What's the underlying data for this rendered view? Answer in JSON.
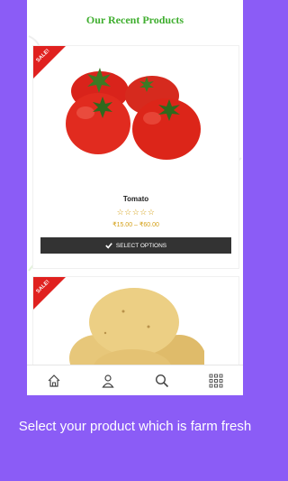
{
  "colors": {
    "background": "#8b5cf6",
    "title_green": "#3fae2f",
    "sale_red": "#e0211f",
    "price_gold": "#d4a017",
    "button_dark": "#333333"
  },
  "section": {
    "title": "Our Recent Products"
  },
  "products": [
    {
      "badge": "SALE!",
      "name": "Tomato",
      "rating_stars": "☆☆☆☆☆",
      "price": "₹15.00 – ₹60.00",
      "button_label": "SELECT OPTIONS",
      "button_icon": "check-icon"
    },
    {
      "badge": "SALE!"
    }
  ],
  "bottom_nav": {
    "items": [
      "home-icon",
      "account-icon",
      "search-icon",
      "grid-menu-icon"
    ]
  },
  "caption": "Select your product which is farm fresh"
}
